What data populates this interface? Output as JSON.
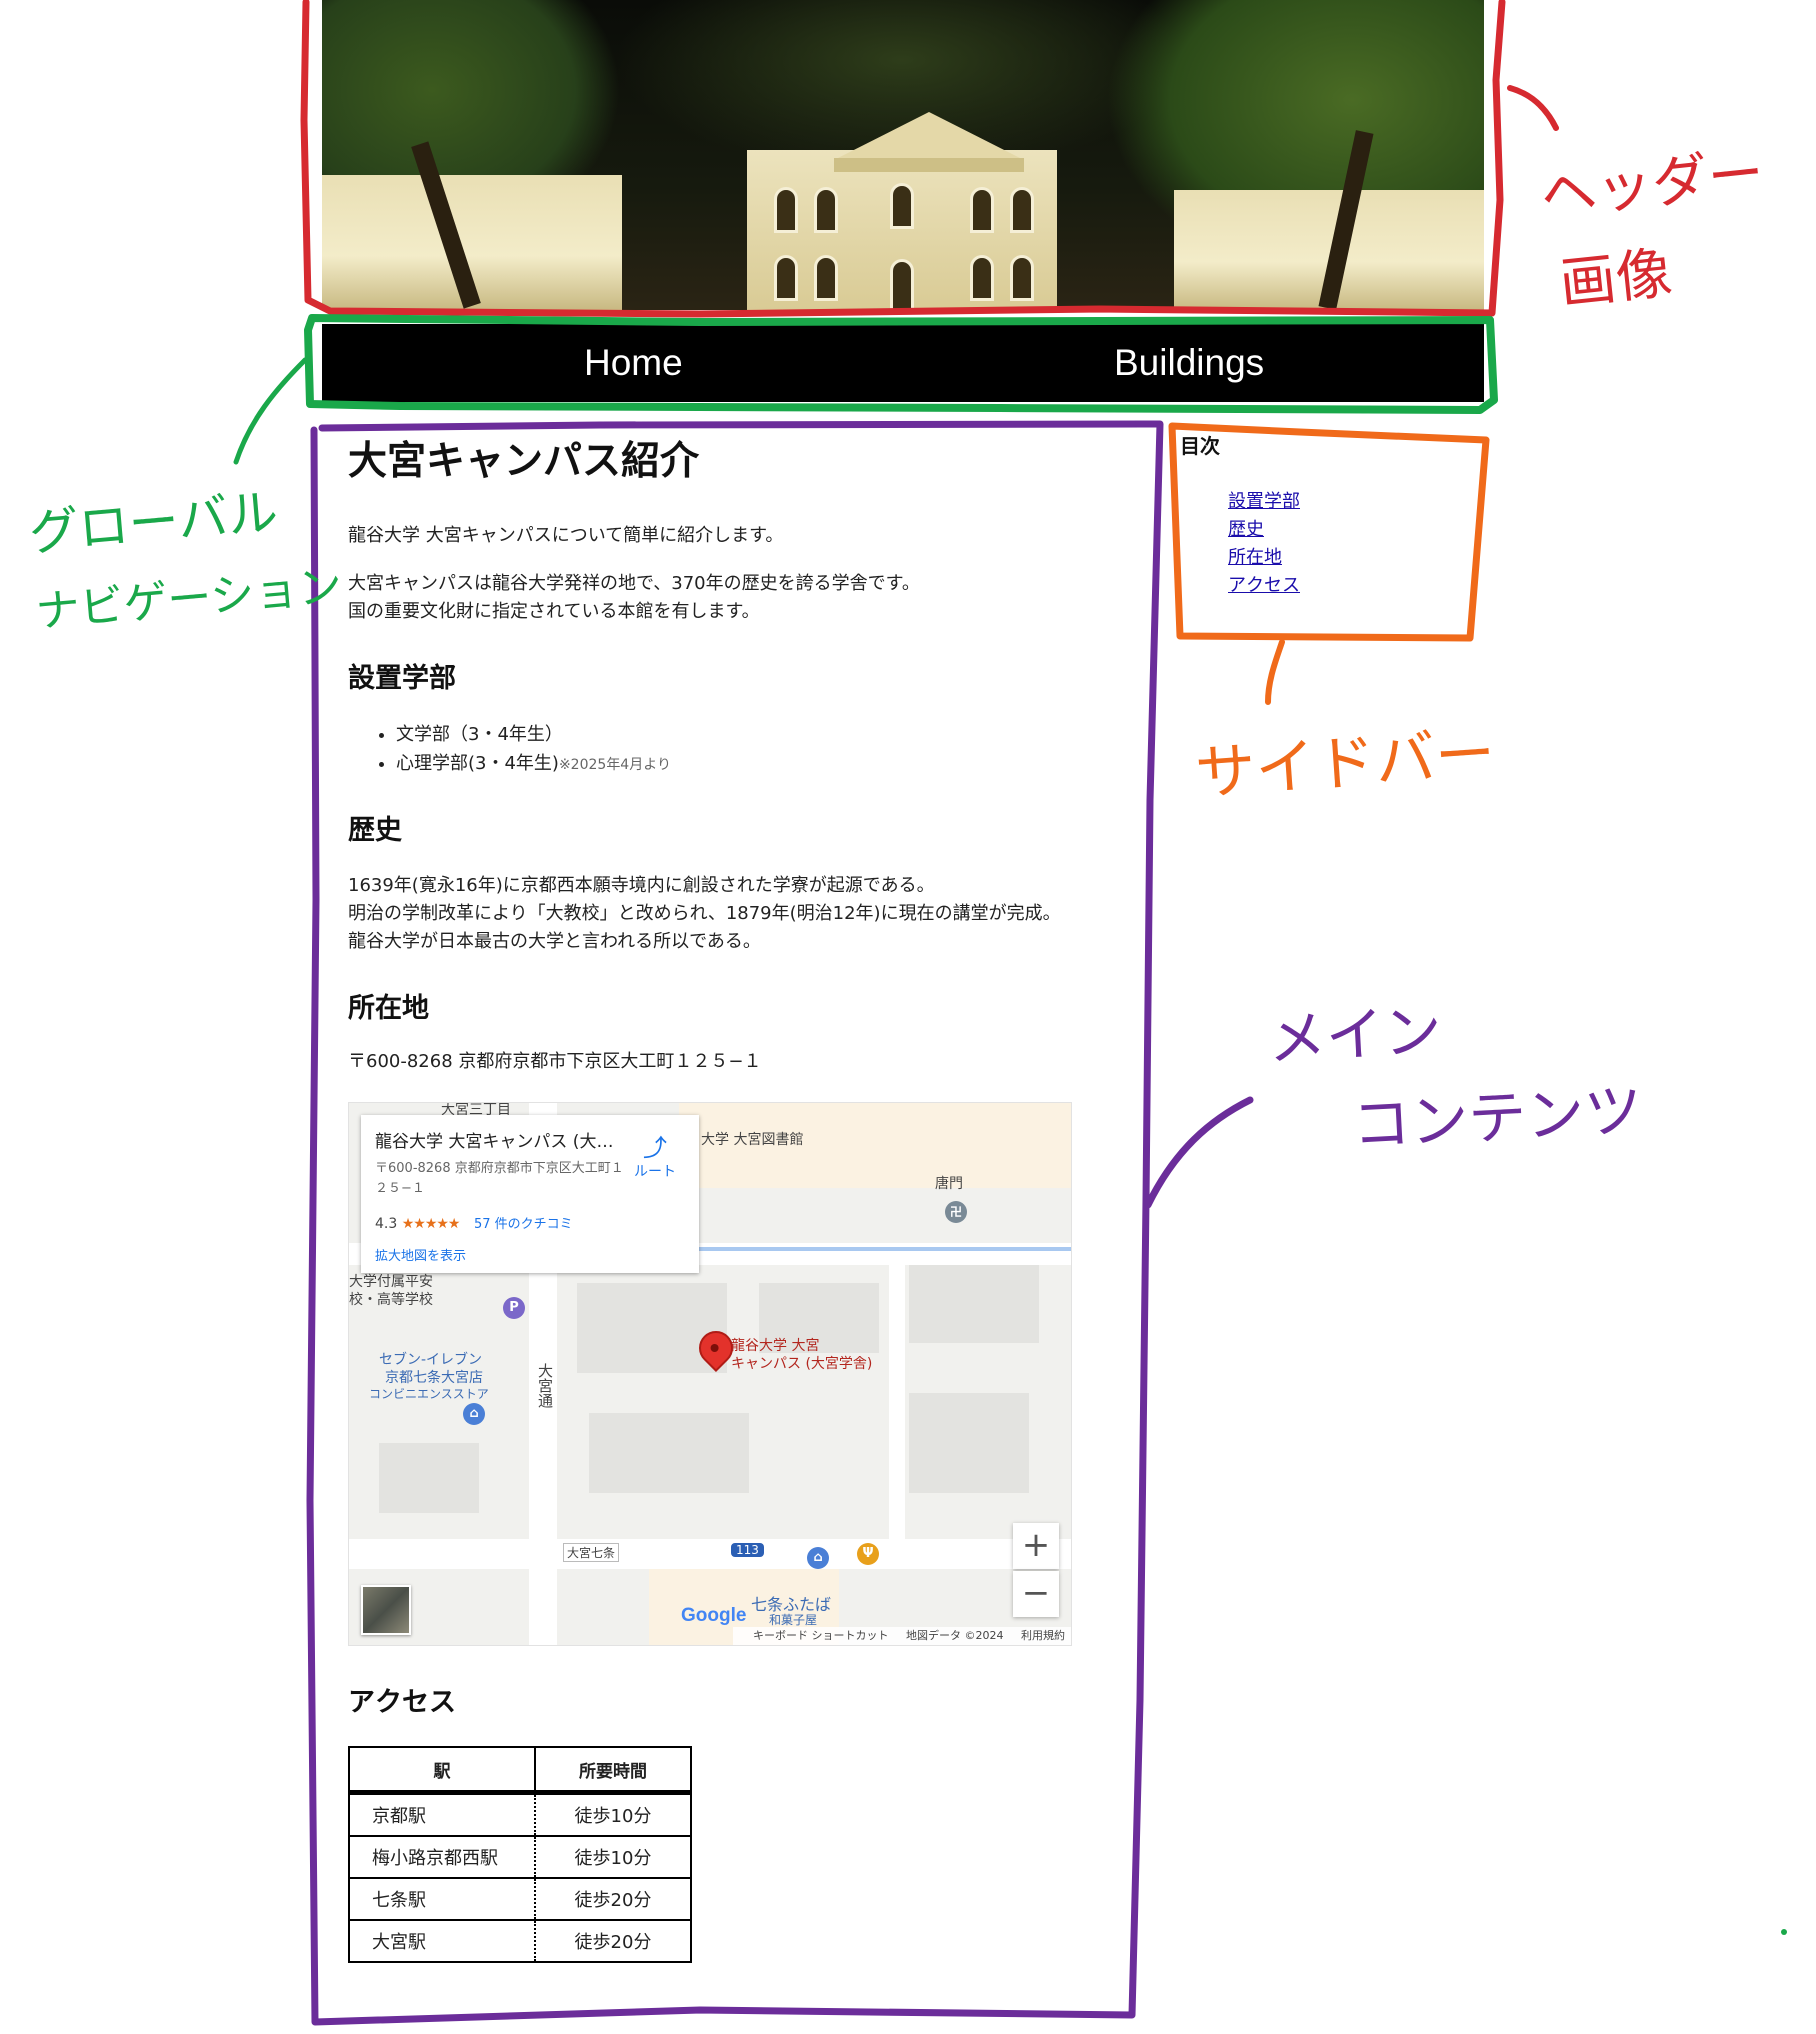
{
  "header": {
    "image_alt": "大宮キャンパス本館 夜景"
  },
  "global_nav": {
    "home": "Home",
    "buildings": "Buildings"
  },
  "main": {
    "title": "大宮キャンパス紹介",
    "intro": "龍谷大学 大宮キャンパスについて簡単に紹介します。",
    "desc_line1": "大宮キャンパスは龍谷大学発祥の地で、370年の歴史を誇る学舎です。",
    "desc_line2": "国の重要文化財に指定されている本館を有します。",
    "faculties": {
      "heading": "設置学部",
      "items": [
        {
          "label": "文学部（3・4年生）",
          "note": ""
        },
        {
          "label": "心理学部(3・4年生)",
          "note": "※2025年4月より"
        }
      ]
    },
    "history": {
      "heading": "歴史",
      "line1": "1639年(寛永16年)に京都西本願寺境内に創設された学寮が起源である。",
      "line2": "明治の学制改革により「大教校」と改められ、1879年(明治12年)に現在の講堂が完成。",
      "line3": "龍谷大学が日本最古の大学と言われる所以である。"
    },
    "location": {
      "heading": "所在地",
      "address": "〒600-8268 京都府京都市下京区大工町１２５−１"
    },
    "map": {
      "card_title": "龍谷大学 大宮キャンパス (大…",
      "card_address": "〒600-8268 京都府京都市下京区大工町１２５−１",
      "rating": "4.3",
      "stars": "★★★★★",
      "reviews": "57 件のクチコミ",
      "route": "ルート",
      "bigger_map": "拡大地図を表示",
      "pin_label_1": "龍谷大学 大宮",
      "pin_label_2": "キャンパス (大宮学舎)",
      "labels": {
        "library": "大学 大宮図書館",
        "karamon": "唐門",
        "school_1": "大学付属平安",
        "school_2": "校・高等学校",
        "seven_1": "セブン-イレブン",
        "seven_2": "京都七条大宮店",
        "seven_3": "コンビニエンスストア",
        "omiya_dori": "大宮通",
        "omiya_shichijo": "大宮七条",
        "route_113": "113",
        "shichijo_futaba": "七条ふたば",
        "wagashi": "和菓子屋",
        "street_top": "大宮三丁目"
      },
      "google": "Google",
      "footer_shortcuts": "キーボード ショートカット",
      "footer_data": "地図データ ©2024",
      "footer_terms": "利用規約",
      "zoom_in": "+",
      "zoom_out": "−"
    },
    "access": {
      "heading": "アクセス",
      "columns": [
        "駅",
        "所要時間"
      ],
      "rows": [
        [
          "京都駅",
          "徒歩10分"
        ],
        [
          "梅小路京都西駅",
          "徒歩10分"
        ],
        [
          "七条駅",
          "徒歩20分"
        ],
        [
          "大宮駅",
          "徒歩20分"
        ]
      ]
    }
  },
  "sidebar": {
    "title": "目次",
    "items": [
      "設置学部",
      "歴史",
      "所在地",
      "アクセス"
    ]
  },
  "annotations": {
    "header_1": "ヘッダー",
    "header_2": "画像",
    "gnav_1": "グローバル",
    "gnav_2": "ナビゲーション",
    "sidebar": "サイドバー",
    "main_1": "メイン",
    "main_2": "コンテンツ"
  },
  "colors": {
    "header_box": "#d62a30",
    "gnav_box": "#1aa84a",
    "sidebar_box": "#f06a1a",
    "main_box": "#6b2d9a",
    "nav_bg": "#000000",
    "link": "#1a0dab"
  }
}
